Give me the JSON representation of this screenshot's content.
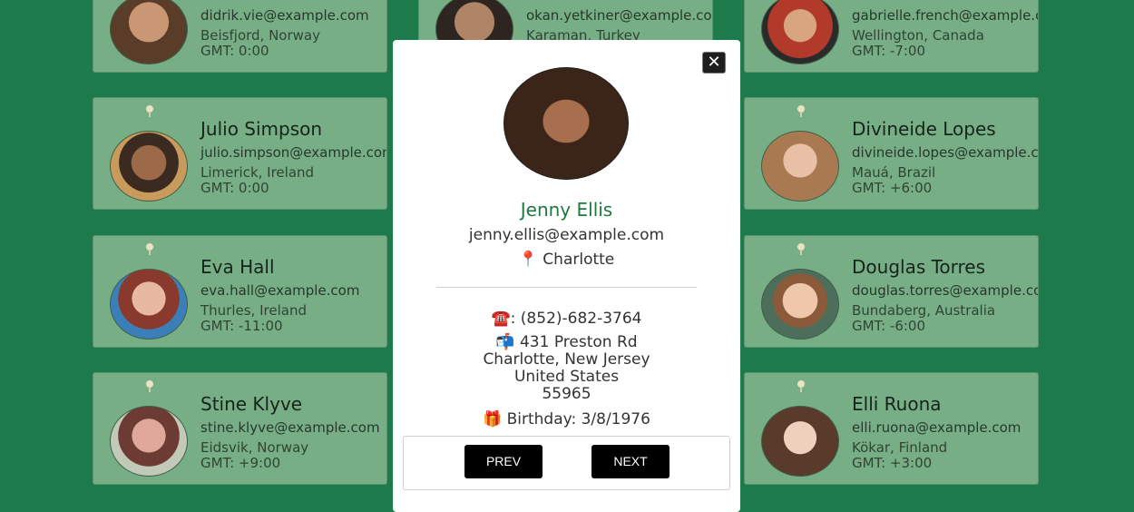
{
  "cards": [
    {
      "name": "",
      "email": "didrik.vie@example.com",
      "location": "Beisfjord, Norway",
      "timezone": "GMT: 0:00"
    },
    {
      "name": "",
      "email": "okan.yetkiner@example.com",
      "location": "Karaman, Turkey",
      "timezone": ""
    },
    {
      "name": "",
      "email": "gabrielle.french@example.com",
      "location": "Wellington, Canada",
      "timezone": "GMT: -7:00"
    },
    {
      "name": "Julio Simpson",
      "email": "julio.simpson@example.com",
      "location": "Limerick, Ireland",
      "timezone": "GMT: 0:00"
    },
    {
      "name": "Divineide Lopes",
      "email": "divineide.lopes@example.com",
      "location": "Mauá, Brazil",
      "timezone": "GMT: +6:00"
    },
    {
      "name": "Eva Hall",
      "email": "eva.hall@example.com",
      "location": "Thurles, Ireland",
      "timezone": "GMT: -11:00"
    },
    {
      "name": "Douglas Torres",
      "email": "douglas.torres@example.com",
      "location": "Bundaberg, Australia",
      "timezone": "GMT: -6:00"
    },
    {
      "name": "Stine Klyve",
      "email": "stine.klyve@example.com",
      "location": "Eidsvik, Norway",
      "timezone": "GMT: +9:00"
    },
    {
      "name": "Elli Ruona",
      "email": "elli.ruona@example.com",
      "location": "Kökar, Finland",
      "timezone": "GMT: +3:00"
    }
  ],
  "modal": {
    "close_label": "✕",
    "name": "Jenny Ellis",
    "email": "jenny.ellis@example.com",
    "city_icon": "📍",
    "city": "Charlotte",
    "phone_icon": "☎️",
    "phone": ": (852)-682-3764",
    "address_icon": "📬",
    "street": "431 Preston Rd",
    "city_state": "Charlotte, New Jersey",
    "country": "United States",
    "postcode": "55965",
    "birthday_icon": "🎁",
    "birthday": "Birthday: 3/8/1976",
    "prev_label": "PREV",
    "next_label": "NEXT"
  },
  "colors": {
    "page_bg": "#1d7a4a",
    "card_bg": "#77ae86",
    "modal_name": "#1e7a3f"
  }
}
